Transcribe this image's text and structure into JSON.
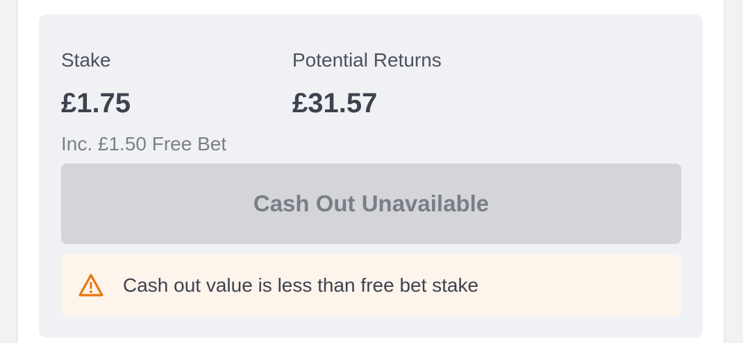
{
  "bet_summary": {
    "stake": {
      "label": "Stake",
      "amount": "£1.75",
      "note": "Inc. £1.50 Free Bet"
    },
    "potential_returns": {
      "label": "Potential Returns",
      "amount": "£31.57"
    }
  },
  "cash_out": {
    "button_label": "Cash Out Unavailable",
    "disabled": true
  },
  "warning": {
    "icon": "warning-triangle-icon",
    "message": "Cash out value is less than free bet stake"
  },
  "colors": {
    "panel_background": "#f0f1f5",
    "button_disabled": "#d4d5d8",
    "warning_background": "#fdf4ec",
    "warning_icon": "#e8750b"
  }
}
